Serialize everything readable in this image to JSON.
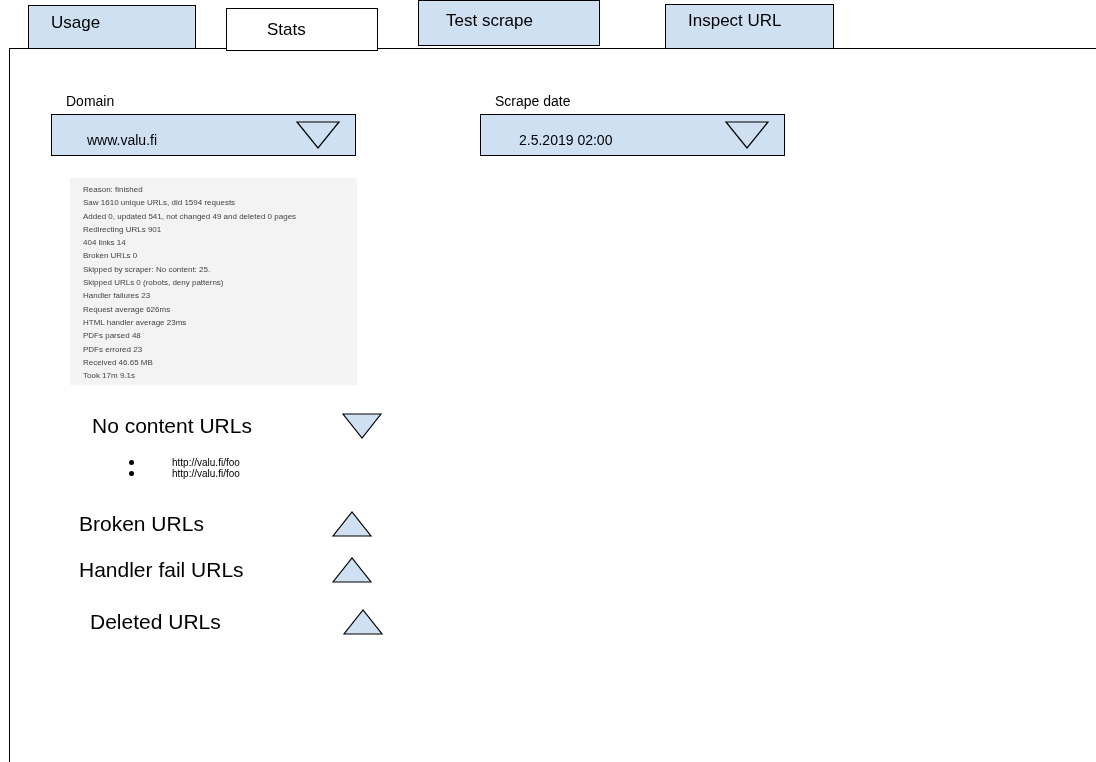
{
  "tabs": [
    {
      "label": "Usage",
      "selected": false
    },
    {
      "label": "Stats",
      "selected": true
    },
    {
      "label": "Test scrape",
      "selected": false
    },
    {
      "label": "Inspect URL",
      "selected": false
    }
  ],
  "domain": {
    "label": "Domain",
    "value": "www.valu.fi"
  },
  "scrape_date": {
    "label": "Scrape date",
    "value": "2.5.2019 02:00"
  },
  "stats": [
    "Reason: finished",
    "Saw 1610 unique URLs, did 1594 requests",
    "Added 0, updated 541, not changed 49 and deleted 0 pages",
    "Redirecting URLs 901",
    "404 links  14",
    "Broken URLs  0",
    "Skipped by scraper: No content: 25.",
    "Skipped URLs  0 (robots, deny patterns)",
    "Handler failures 23",
    "Request average 626ms",
    "HTML handler average 23ms",
    "PDFs parsed 48",
    "PDFs errored 23",
    "Received 46.65 MB",
    "Took 17m 9.1s"
  ],
  "sections": [
    {
      "title": "No content URLs",
      "expanded": true,
      "items": [
        "http://valu.fi/foo",
        "http://valu.fi/foo"
      ]
    },
    {
      "title": "Broken URLs",
      "expanded": false
    },
    {
      "title": "Handler fail URLs",
      "expanded": false
    },
    {
      "title": "Deleted URLs",
      "expanded": false
    }
  ]
}
